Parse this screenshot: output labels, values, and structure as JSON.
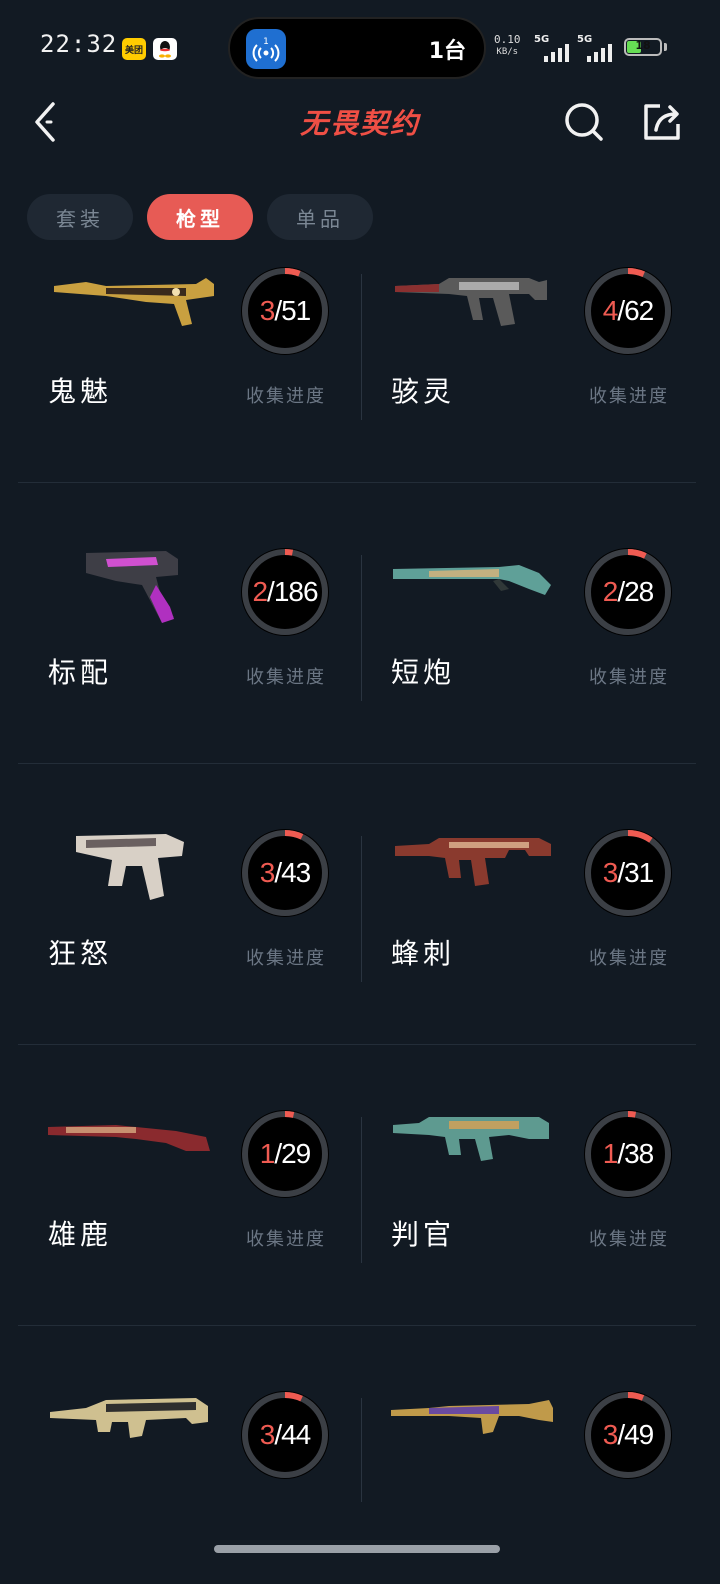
{
  "status_bar": {
    "time": "22:32",
    "app_badge_1": "美团",
    "island_badge": "1",
    "island_text": "1台",
    "net_speed_value": "0.10",
    "net_speed_unit": "KB/s",
    "signal_1": "5G",
    "signal_2": "5G",
    "battery": "18",
    "battery_level": 0.18
  },
  "header": {
    "title": "无畏契约"
  },
  "tabs": [
    {
      "label": "套装",
      "active": false
    },
    {
      "label": "枪型",
      "active": true
    },
    {
      "label": "单品",
      "active": false
    }
  ],
  "progress_label": "收集进度",
  "colors": {
    "accent": "#ef5b52",
    "background": "#121a23",
    "tab_bg": "#1f2833"
  },
  "weapons": [
    {
      "name": "鬼魅",
      "owned": "3",
      "total": "51",
      "icon": "pistol-ghost-icon"
    },
    {
      "name": "骇灵",
      "owned": "4",
      "total": "62",
      "icon": "smg-spectre-icon"
    },
    {
      "name": "标配",
      "owned": "2",
      "total": "186",
      "icon": "pistol-classic-icon"
    },
    {
      "name": "短炮",
      "owned": "2",
      "total": "28",
      "icon": "shotgun-shorty-icon"
    },
    {
      "name": "狂怒",
      "owned": "3",
      "total": "43",
      "icon": "pistol-frenzy-icon"
    },
    {
      "name": "蜂刺",
      "owned": "3",
      "total": "31",
      "icon": "smg-stinger-icon"
    },
    {
      "name": "雄鹿",
      "owned": "1",
      "total": "29",
      "icon": "shotgun-bucky-icon"
    },
    {
      "name": "判官",
      "owned": "1",
      "total": "38",
      "icon": "shotgun-judge-icon"
    },
    {
      "name": "",
      "owned": "3",
      "total": "44",
      "icon": "rifle-bulldog-icon"
    },
    {
      "name": "",
      "owned": "3",
      "total": "49",
      "icon": "rifle-guardian-icon"
    }
  ]
}
